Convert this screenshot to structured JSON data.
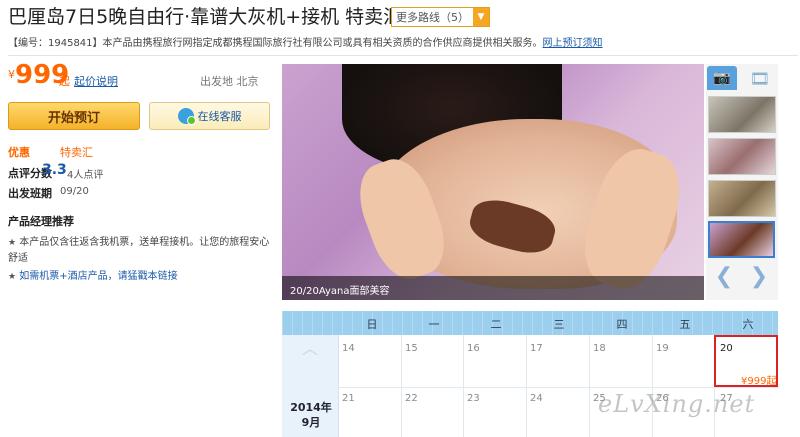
{
  "header": {
    "title": "巴厘岛7日5晚自由行·靠谱大灰机+接机 特卖汇",
    "more_routes_label": "更多路线（5）",
    "notice_prefix": "【编号：1945841】本产品由携程旅行网指定成都携程国际旅行社有限公司或具有相关资质的合作供应商提供相关服务。",
    "notice_link": "网上预订须知"
  },
  "price": {
    "currency": "¥",
    "value": "999",
    "suffix": "起",
    "explain_link": "起价说明",
    "departure": "出发地 北京"
  },
  "actions": {
    "book_label": "开始预订",
    "service_label": "在线客服"
  },
  "info": {
    "promo_label": "优惠",
    "promo_value": "特卖汇",
    "score_label": "点评分数",
    "score_value": "3.3",
    "score_count": "4人点评",
    "departure_label": "出发班期",
    "departure_value": "09/20"
  },
  "manager": {
    "title": "产品经理推荐",
    "items": [
      "本产品仅含往返含我机票，送单程接机。让您的旅程安心舒适",
      "如需机票+酒店产品，请猛戳本链接"
    ],
    "star": "★"
  },
  "gallery": {
    "caption": "20/20Ayana面部美容",
    "camera_icon": "camera-icon",
    "video_icon": "video-icon",
    "prev": "❮",
    "next": "❯"
  },
  "calendar": {
    "weekdays": [
      "日",
      "一",
      "二",
      "三",
      "四",
      "五",
      "六"
    ],
    "year_label": "2014年",
    "month_label": "9月",
    "week1": [
      "14",
      "15",
      "16",
      "17",
      "18",
      "19",
      "20"
    ],
    "week2": [
      "21",
      "22",
      "23",
      "24",
      "25",
      "26",
      "27"
    ],
    "selected_price": "¥999起",
    "up_arrow": "︿"
  },
  "watermark": "eLvXing.net",
  "colors": {
    "accent": "#ff6600",
    "link": "#1a5aa8",
    "calendar_header": "#9ccfee",
    "selected_border": "#dd2222"
  }
}
